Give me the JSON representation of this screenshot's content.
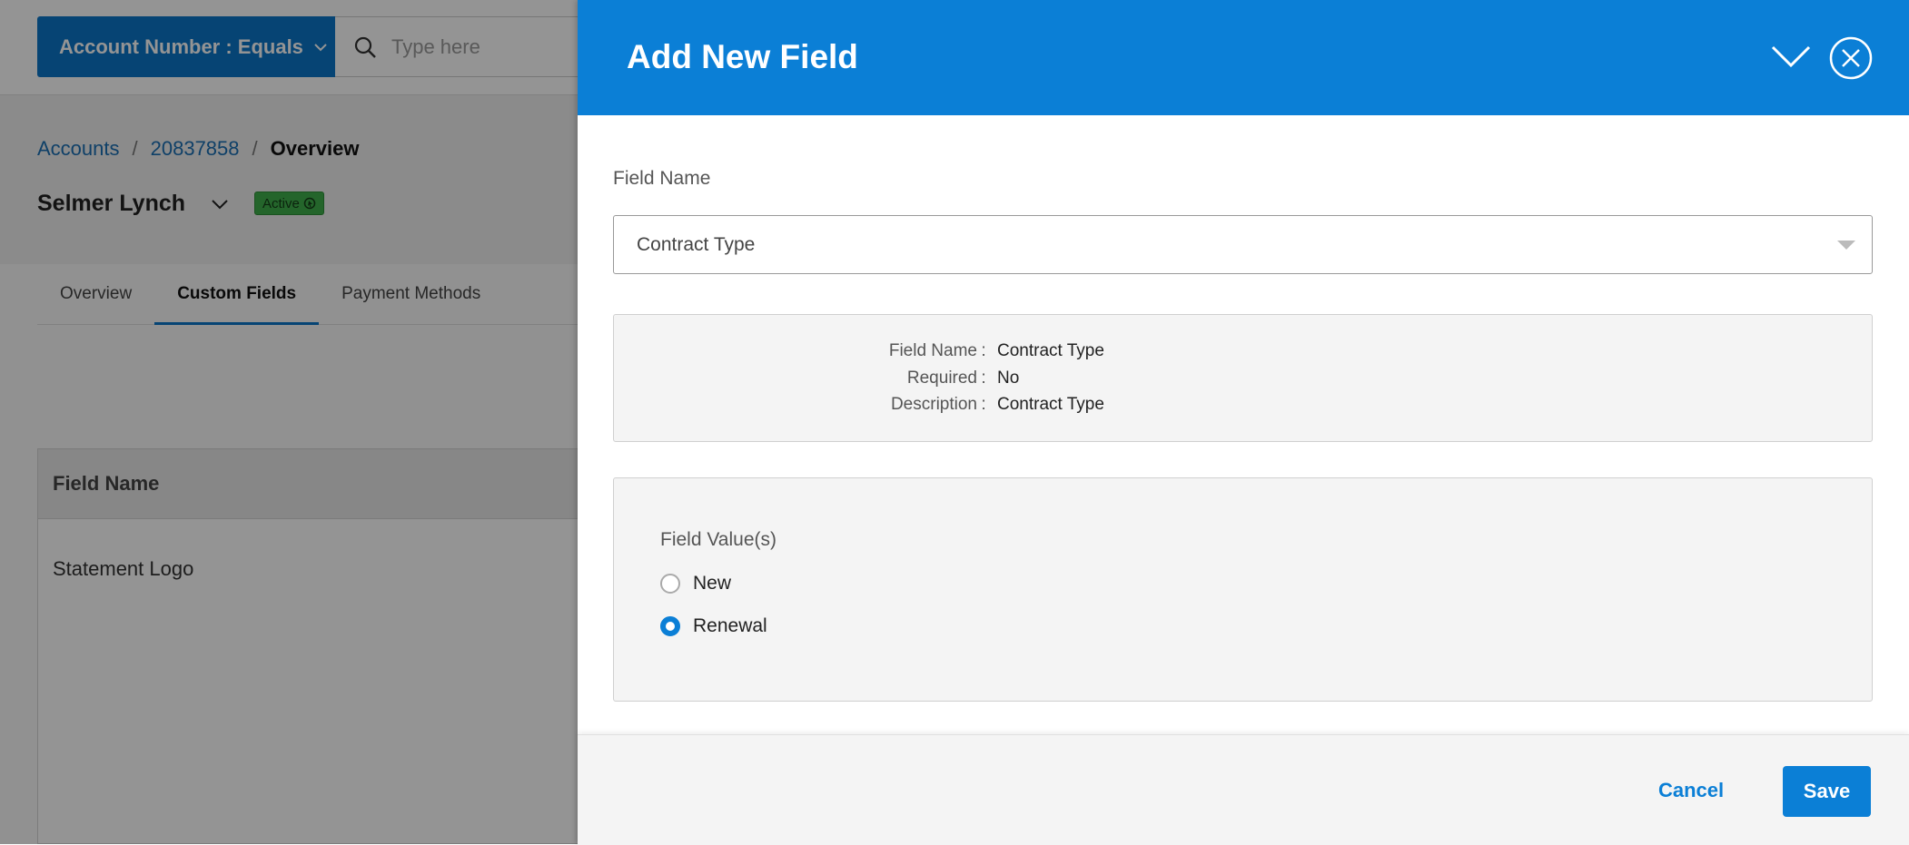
{
  "background": {
    "filter_label": "Account Number : Equals",
    "search_placeholder": "Type here",
    "breadcrumb": {
      "accounts": "Accounts",
      "sep1": "/",
      "account_id": "20837858",
      "sep2": "/",
      "current": "Overview"
    },
    "account_name": "Selmer Lynch",
    "status": "Active",
    "tabs": [
      "Overview",
      "Custom Fields",
      "Payment Methods"
    ],
    "table": {
      "header": "Field Name",
      "rows": [
        "Statement Logo"
      ]
    }
  },
  "drawer": {
    "title": "Add New Field",
    "field_name_label": "Field Name",
    "field_name_value": "Contract Type",
    "info": [
      {
        "key": "Field Name",
        "value": "Contract Type"
      },
      {
        "key": "Required",
        "value": "No"
      },
      {
        "key": "Description",
        "value": "Contract Type"
      }
    ],
    "colon": ":",
    "values_label": "Field Value(s)",
    "options": [
      {
        "label": "New",
        "checked": false
      },
      {
        "label": "Renewal",
        "checked": true
      }
    ],
    "cancel_label": "Cancel",
    "save_label": "Save"
  },
  "colors": {
    "accent": "#0b7fd6",
    "status_green": "#3fae4a"
  }
}
